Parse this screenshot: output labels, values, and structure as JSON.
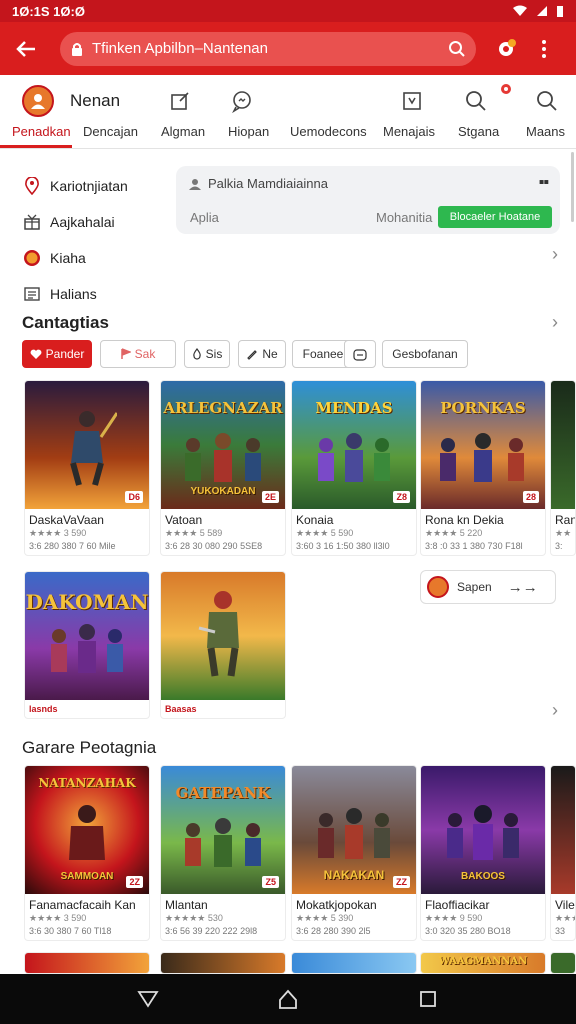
{
  "status_bar": {
    "time": "1Ø:1S 1Ø:Ø"
  },
  "appbar": {
    "search_text": "Tfinken Apbilbn–Nantenan",
    "colors": {
      "bar": "#d91e1e",
      "status": "#c4151c"
    }
  },
  "brand": {
    "name": "Nenan"
  },
  "tabs": [
    {
      "label": "Penadkan",
      "icon": ""
    },
    {
      "label": "Dencajan",
      "icon": "edit-icon"
    },
    {
      "label": "Algman",
      "icon": ""
    },
    {
      "label": "Hiopan",
      "icon": "chat-icon"
    },
    {
      "label": "Uemodecons",
      "icon": ""
    },
    {
      "label": "Menajais",
      "icon": "bookmark-icon"
    },
    {
      "label": "Stgana",
      "icon": "search-icon"
    },
    {
      "label": "Maans",
      "icon": "search-icon"
    }
  ],
  "side_menu": [
    {
      "label": "Kariotnjiatan",
      "icon": "location-icon"
    },
    {
      "label": "Aajkahalai",
      "icon": "gift-icon"
    },
    {
      "label": "Kiaha",
      "icon": "orange-circle-icon"
    },
    {
      "label": "Halians",
      "icon": "list-icon"
    }
  ],
  "info_card": {
    "title": "Palkia Mamdiaiainna",
    "label_a": "Aplia",
    "label_b": "Mohanitia",
    "button": "Blocaeler Hoatane"
  },
  "section1": {
    "title": "Cantagtias"
  },
  "chips": [
    {
      "label": "Pander"
    },
    {
      "label": "Sak"
    },
    {
      "label": "Sis"
    },
    {
      "label": "Ne"
    },
    {
      "label": "Foaneer"
    },
    {
      "label": ""
    },
    {
      "label": "Gesbofanan"
    }
  ],
  "row1": [
    {
      "name": "DaskaVaVaan",
      "rating": "★★★★ 3 590",
      "meta": "3:6 280 380 7 60   Mile",
      "cover_title": "",
      "cover_sub": "",
      "badge": "D6"
    },
    {
      "name": "Vatoan",
      "rating": "★★★★ 5 589",
      "meta": "3:6 28 30 080 290    5SE8",
      "cover_title": "ARLEGNAZAR",
      "cover_sub": "YUKOKADAN",
      "badge": "2E"
    },
    {
      "name": "Konaia",
      "rating": "★★★★ 5 590",
      "meta": "3:60 3 16 1:50 380   ll3l0",
      "cover_title": "MENDAS",
      "cover_sub": "",
      "badge": "Z8"
    },
    {
      "name": "Rona kn Dekia",
      "rating": "★★★★ 5 220",
      "meta": "3:8 :0 33 1 380 730   F18l",
      "cover_title": "PORNKAS",
      "cover_sub": "",
      "badge": "28"
    },
    {
      "name": "Ran",
      "rating": "★★",
      "meta": "3:",
      "cover_title": "",
      "cover_sub": "",
      "badge": ""
    }
  ],
  "row2": [
    {
      "tag": "lasnds",
      "cover_title": "DAKOMAN",
      "badge": ""
    },
    {
      "tag": "Baasas",
      "cover_title": "",
      "badge": ""
    }
  ],
  "user_pill": {
    "label": "Sapen",
    "arrow": "→→"
  },
  "section2": {
    "title": "Garare Peotagnia"
  },
  "row3": [
    {
      "name": "Fanamacfacaih Kan",
      "rating": "★★★★ 3 590",
      "meta": "3:6 30 380 7 60   Tl18",
      "cover_title": "NATANZAHAK",
      "cover_sub": "SAMMOAN",
      "badge": "2Z"
    },
    {
      "name": "Mlantan",
      "rating": "★★★★★ 530",
      "meta": "3:6 56 39 220 222   29l8",
      "cover_title": "GATEPANK",
      "cover_sub": "",
      "badge": "Z5"
    },
    {
      "name": "Mokatkjopokan",
      "rating": "★★★★ 5 390",
      "meta": "3:6 28 280 390    2l5",
      "cover_title": "",
      "cover_sub": "NAKAKAN",
      "badge": "ZZ"
    },
    {
      "name": "Flaoffiacikar",
      "rating": "★★★★ 9 590",
      "meta": "3:0 320 35 280   BO18",
      "cover_title": "",
      "cover_sub": "BAKOOS",
      "badge": ""
    },
    {
      "name": "Vile",
      "rating": "★★★",
      "meta": "33",
      "cover_title": "",
      "cover_sub": "",
      "badge": ""
    }
  ],
  "row4": [
    {
      "cover_title": ""
    },
    {
      "cover_title": ""
    },
    {
      "cover_title": ""
    },
    {
      "cover_title": "WAAGMANNAN"
    },
    {
      "cover_title": ""
    }
  ]
}
